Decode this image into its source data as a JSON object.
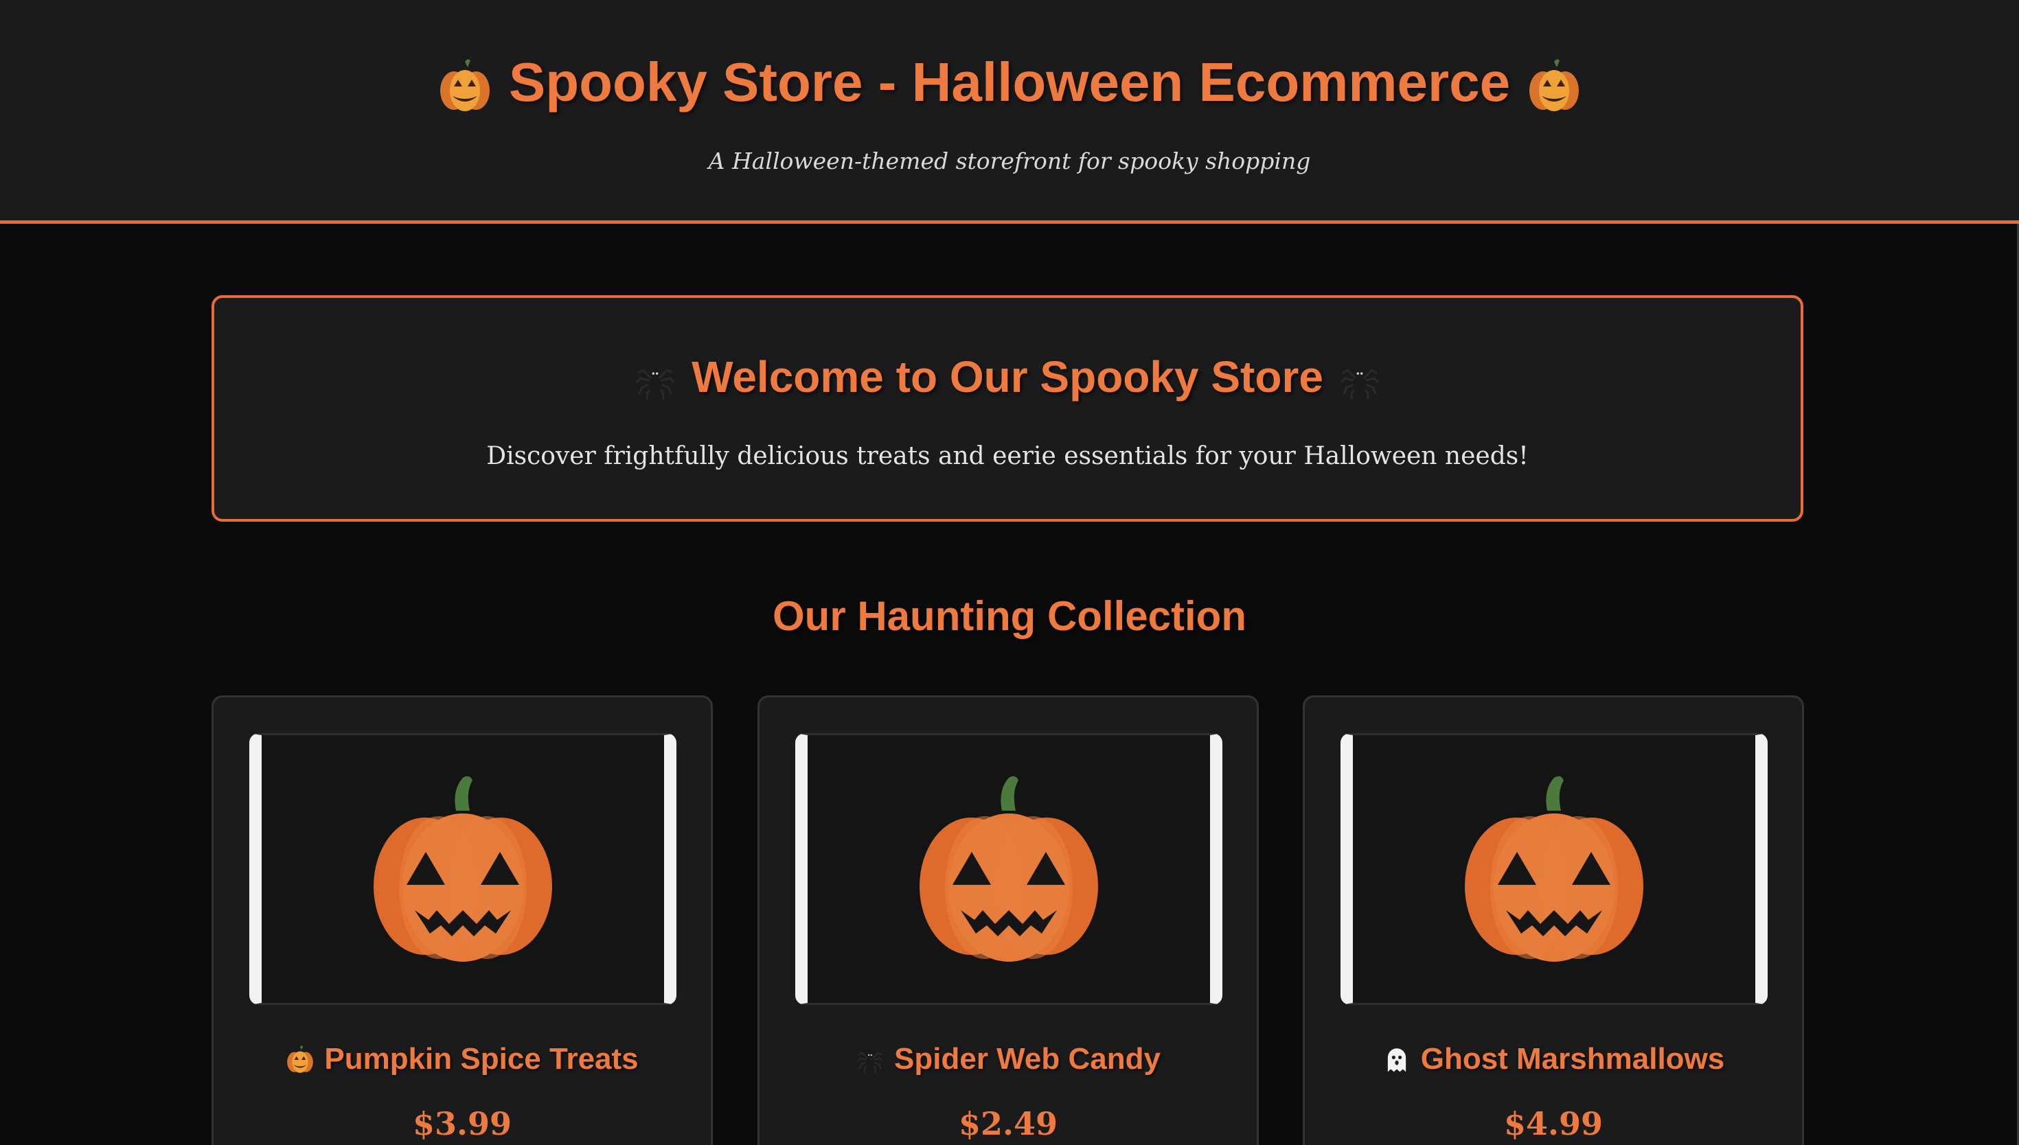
{
  "header": {
    "title": "Spooky Store - Halloween Ecommerce",
    "title_left_icon": "jack-o-lantern-icon",
    "title_right_icon": "jack-o-lantern-icon",
    "subtitle": "A Halloween-themed storefront for spooky shopping"
  },
  "welcome": {
    "title": "Welcome to Our Spooky Store",
    "title_icon": "spider-icon",
    "text": "Discover frightfully delicious treats and eerie essentials for your Halloween needs!"
  },
  "collection": {
    "title": "Our Haunting Collection"
  },
  "products": [
    {
      "name": "Pumpkin Spice Treats",
      "icon": "jack-o-lantern-icon",
      "price": "$3.99",
      "image": "pumpkin-image"
    },
    {
      "name": "Spider Web Candy",
      "icon": "spider-icon",
      "price": "$2.49",
      "image": "pumpkin-image"
    },
    {
      "name": "Ghost Marshmallows",
      "icon": "ghost-icon",
      "price": "$4.99",
      "image": "pumpkin-image"
    }
  ],
  "colors": {
    "accent": "#ef7a3f",
    "border_accent": "#e86c36",
    "background": "#0b0b0b",
    "panel": "#1b1b1c",
    "pumpkin": "#e57a3a",
    "stem": "#4c7a3d"
  }
}
